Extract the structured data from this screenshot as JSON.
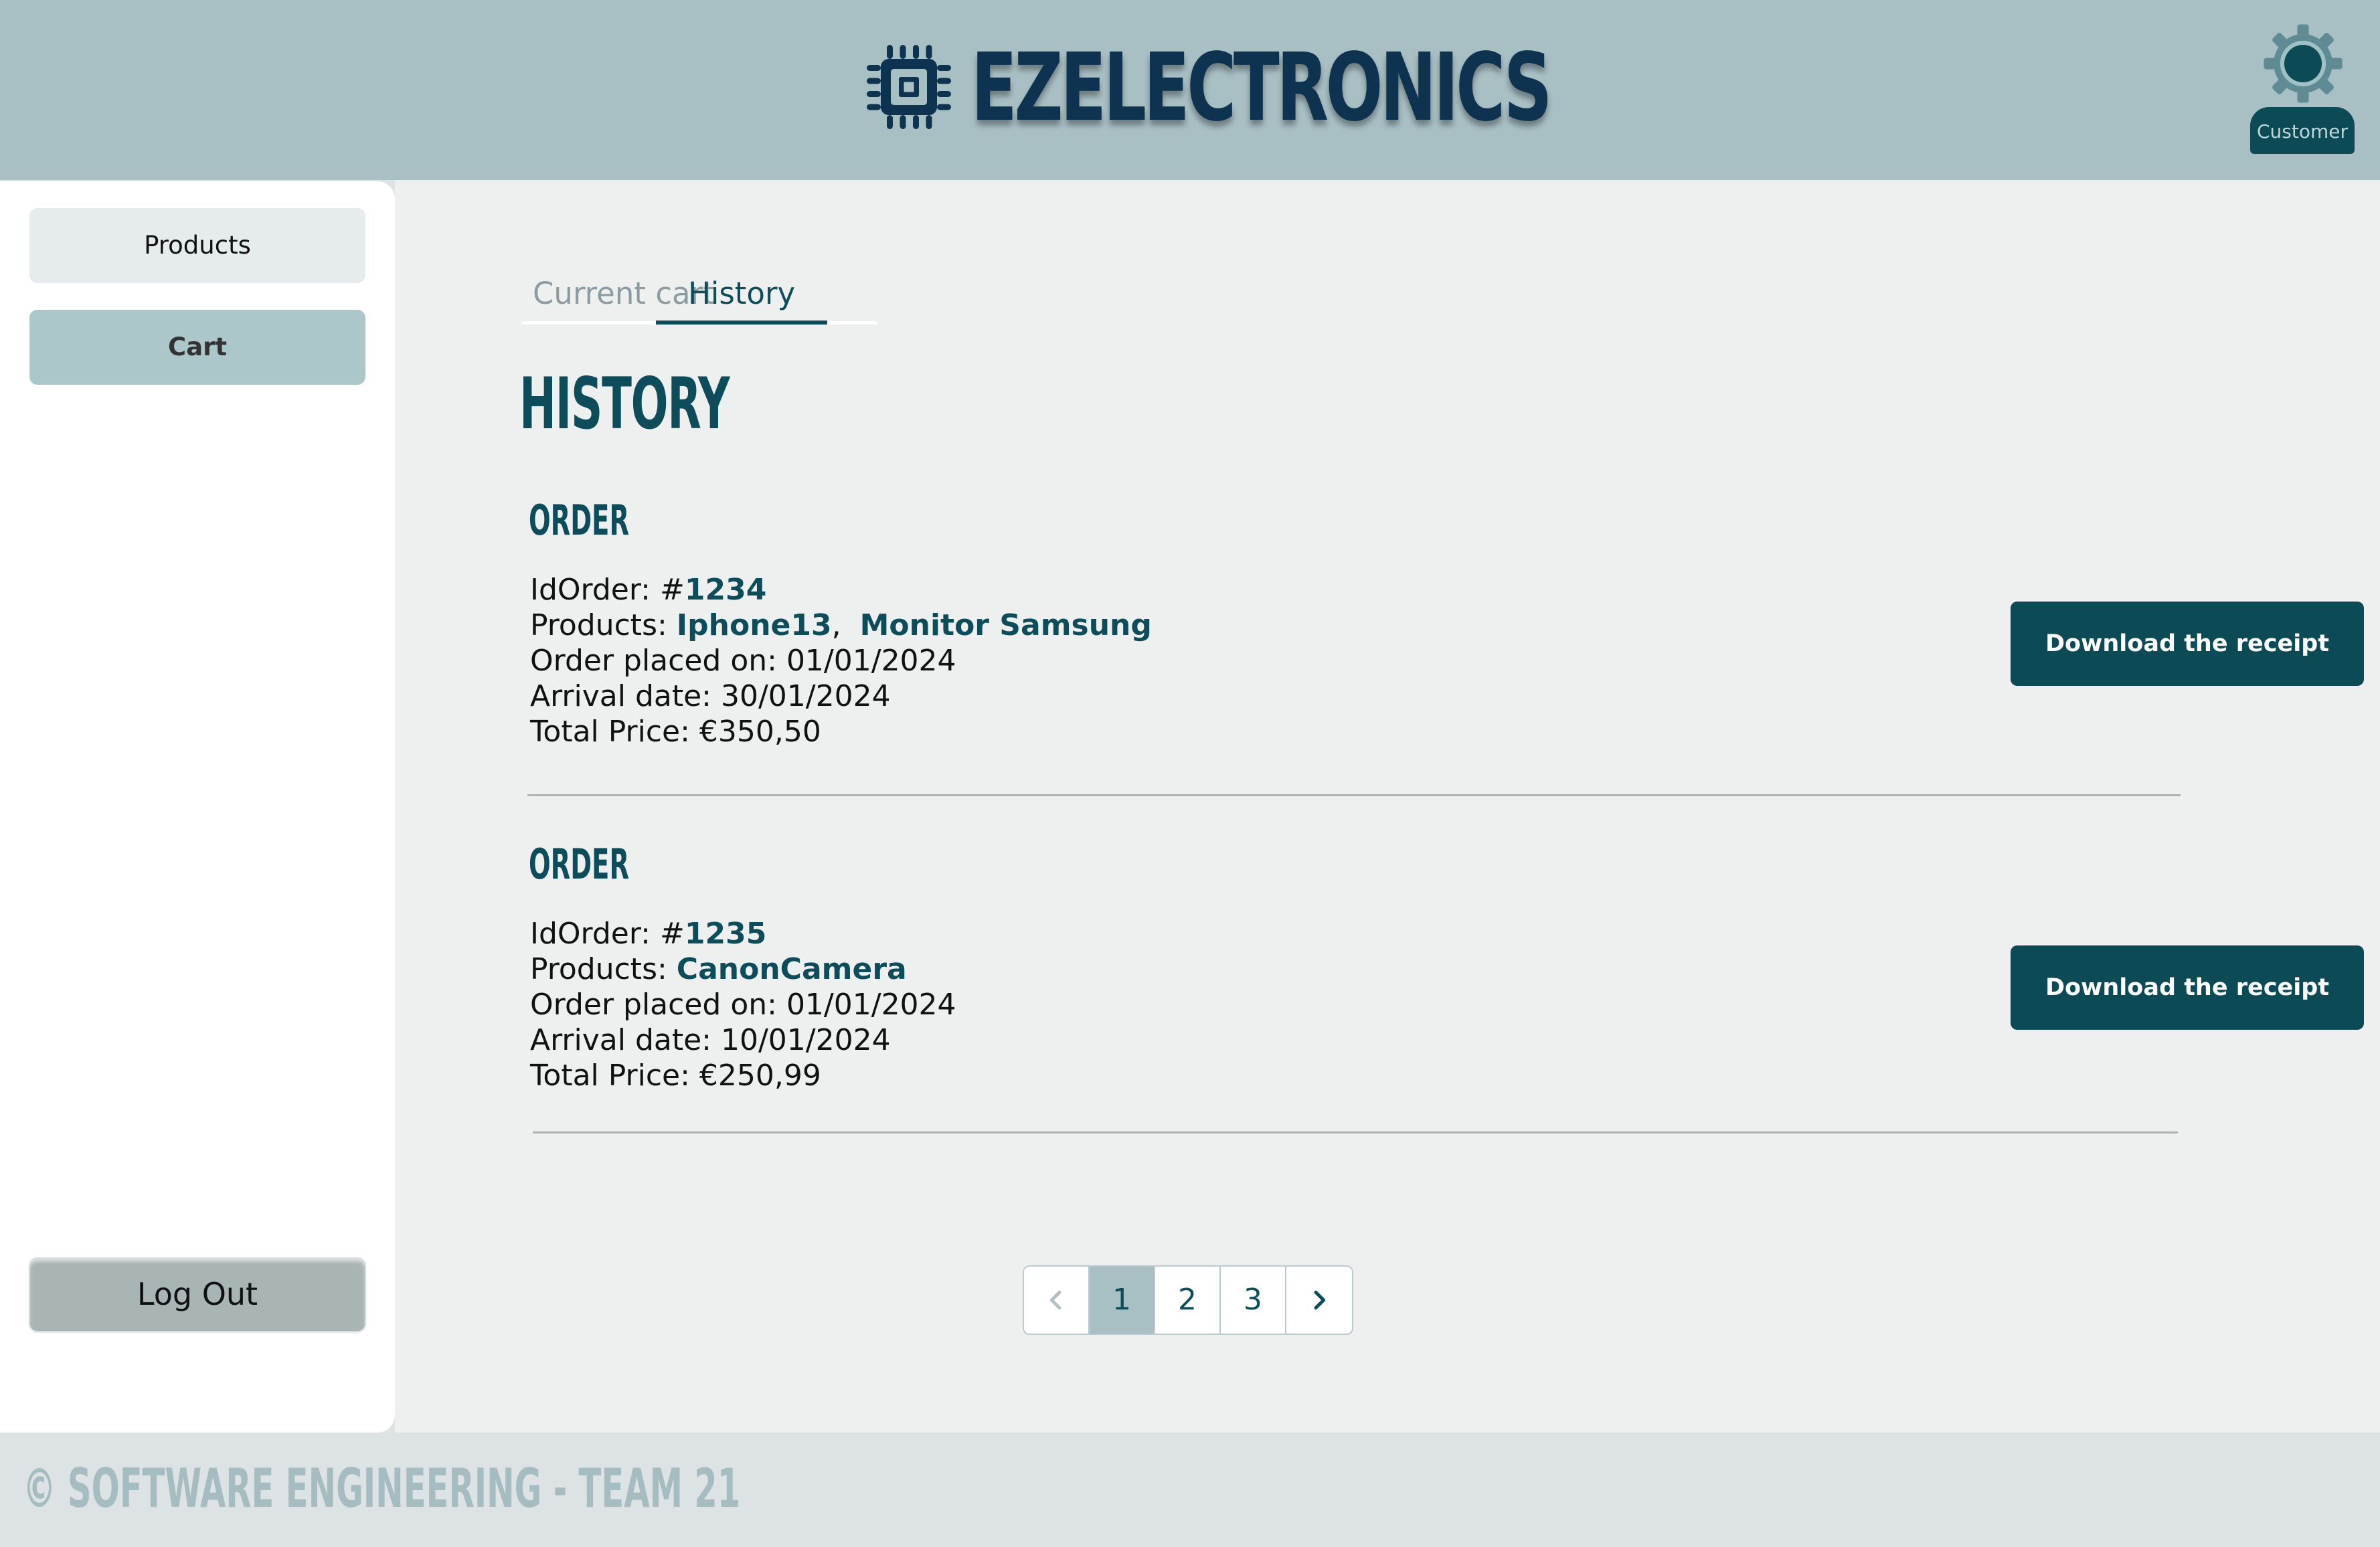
{
  "header": {
    "brand": "EZELECTRONICS",
    "user_role": "Customer"
  },
  "sidebar": {
    "items": [
      {
        "label": "Products"
      },
      {
        "label": "Cart"
      }
    ],
    "logout_label": "Log Out"
  },
  "main": {
    "tabs": [
      {
        "label": "Current cart"
      },
      {
        "label": "History"
      }
    ],
    "title": "HISTORY",
    "orders": [
      {
        "heading": "ORDER",
        "id_label": "IdOrder: #",
        "id": "1234",
        "products_label": "Products: ",
        "products": [
          "Iphone13",
          "Monitor Samsung"
        ],
        "products_separator": ",",
        "placed_on": "Order placed on: 01/01/2024",
        "arrival": "Arrival date: 30/01/2024",
        "total": "Total Price: €350,50",
        "button_label": "Download the receipt"
      },
      {
        "heading": "ORDER",
        "id_label": "IdOrder: #",
        "id": "1235",
        "products_label": "Products: ",
        "products": [
          "CanonCamera"
        ],
        "placed_on": "Order placed on: 01/01/2024",
        "arrival": "Arrival date: 10/01/2024",
        "total": "Total Price: €250,99",
        "button_label": "Download the receipt"
      }
    ],
    "pagination": {
      "pages": [
        "1",
        "2",
        "3"
      ],
      "current": "1",
      "prev_icon": "chevron-left-icon",
      "next_icon": "chevron-right-icon"
    }
  },
  "footer": {
    "text": "© SOFTWARE ENGINEERING - TEAM 21"
  },
  "colors": {
    "header_bg": "#a8bfc4",
    "primary": "#0c4a56",
    "brand_text": "#0d3350",
    "main_bg": "#eef0f0",
    "footer_text": "#a5bcc1"
  }
}
